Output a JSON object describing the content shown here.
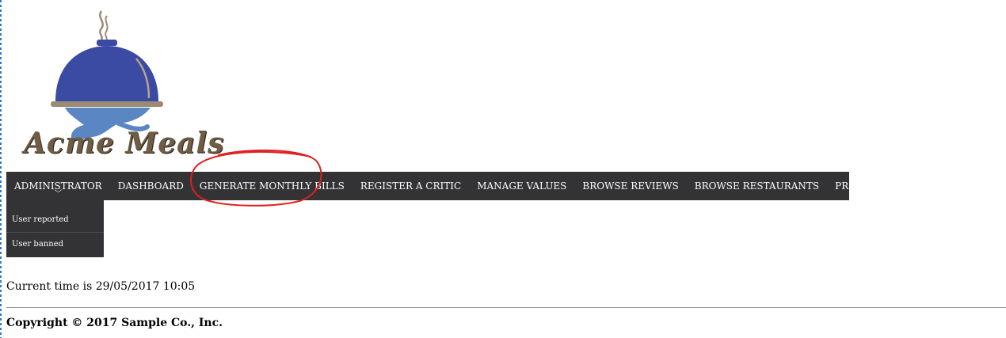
{
  "brand": {
    "logo_text": "Acme Meals"
  },
  "nav": {
    "items": [
      {
        "label": "ADMINISTRATOR"
      },
      {
        "label": "DASHBOARD"
      },
      {
        "label": "GENERATE MONTHLY BILLS"
      },
      {
        "label": "REGISTER A CRITIC"
      },
      {
        "label": "MANAGE VALUES"
      },
      {
        "label": "BROWSE REVIEWS"
      },
      {
        "label": "BROWSE RESTAURANTS"
      },
      {
        "label": "PROFILE (ADMIN)"
      }
    ],
    "chevron": "﹀"
  },
  "dropdown": {
    "items": [
      {
        "label": "User reported"
      },
      {
        "label": "User banned"
      }
    ]
  },
  "main": {
    "welcome_visible": "!",
    "current_time_text": "Current time is 29/05/2017 10:05"
  },
  "footer": {
    "copyright": "Copyright © 2017 Sample Co., Inc."
  },
  "colors": {
    "navbar_bg": "#333235",
    "cloche_blue": "#3b4aa3",
    "hand_blue": "#5b86c4",
    "tray_brown": "#9b8b74",
    "annotation_red": "#e02020"
  }
}
